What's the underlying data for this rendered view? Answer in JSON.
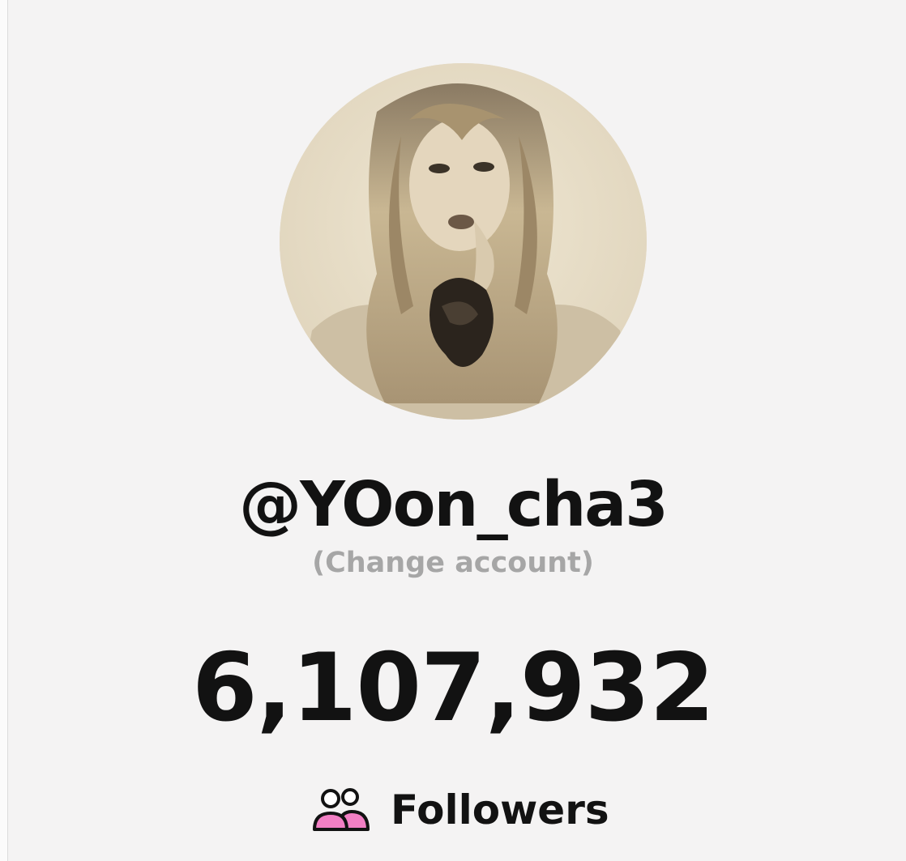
{
  "profile": {
    "handle": "@YOon_cha3",
    "change_account": "(Change account)",
    "avatar_icon": "profile-photo"
  },
  "stats": {
    "follower_count": "6,107,932",
    "followers_label": "Followers",
    "followers_icon": "people-icon"
  },
  "colors": {
    "background": "#f4f3f3",
    "text": "#121212",
    "muted": "#a6a6a6",
    "icon_accent": "#f27fc4"
  }
}
